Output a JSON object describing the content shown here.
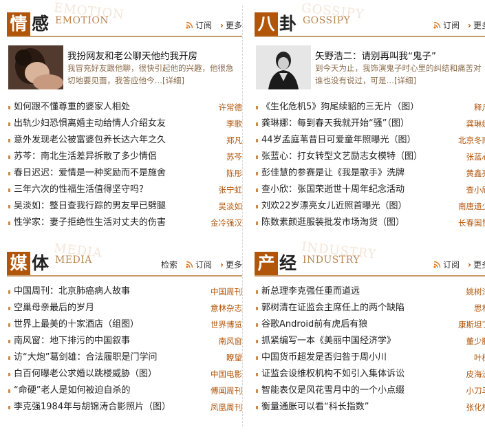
{
  "colors": {
    "accent": "#b1550a",
    "source": "#b1550a",
    "divider": "#c79a6b"
  },
  "emotion": {
    "title_first": "情",
    "title_second": "感",
    "title_en": "EMOTION",
    "links": {
      "subscribe": "订阅",
      "more": "更多"
    },
    "feature": {
      "title": "我扮网友和老公聊天他约我开房",
      "desc": "我冒充好友跟他聊，很快引起他的兴趣，他很急切地要见面，我答应他今…",
      "more": "[详细]"
    },
    "items": [
      {
        "title": "如何跟不懂尊重的婆家人相处",
        "source": "许常德"
      },
      {
        "title": "出轨少妇恐惧离婚主动给情人介绍女友",
        "source": "李歌"
      },
      {
        "title": "意外发现老公被富婆包养长达六年之久",
        "source": "郑凡"
      },
      {
        "title": "苏芩：南北生活差异拆散了多少情侣",
        "source": "苏芩"
      },
      {
        "title": "春日迟迟：爱情是一种奖励而不是施舍",
        "source": "陈彤"
      },
      {
        "title": "三年六次的性福生活值得坚守吗？",
        "source": "张宁虹"
      },
      {
        "title": "吴淡如：整日查我行踪的男友早已劈腿",
        "source": "吴淡如"
      },
      {
        "title": "性学家：妻子拒绝性生活对丈夫的伤害",
        "source": "金冷强汉"
      }
    ]
  },
  "gossip": {
    "title_first": "八",
    "title_second": "卦",
    "title_en": "GOSSIPY",
    "links": {
      "subscribe": "订阅",
      "more": "更多"
    },
    "feature": {
      "title": "矢野浩二：请别再叫我“鬼子”",
      "desc": "到今天为止，我饰演鬼子时心里的纠结和痛苦对谁也没有说过，可是…",
      "more": "[详细]"
    },
    "items": [
      {
        "title": "《生化危机5》狗尾续貂的三无片（图）",
        "source": "释凡"
      },
      {
        "title": "龚琳娜：每到春天我就开始“骚”（图）",
        "source": "龚琳娜"
      },
      {
        "title": "44岁孟庭苇昔日可爱童年照曝光（图）",
        "source": "北京冬雨"
      },
      {
        "title": "张蓝心：打女转型文艺励志女模特（图）",
        "source": "张蓝心"
      },
      {
        "title": "彭佳慧的参赛是让《我是歌手》洗牌",
        "source": "黄鑫亮"
      },
      {
        "title": "查小欣：张国荣逝世十周年纪念活动",
        "source": "查小欣"
      },
      {
        "title": "刘欢22岁漂亮女儿近照首曝光（图）",
        "source": "南唐遗少"
      },
      {
        "title": "陈数素颜逛服装批发市场淘货（图）",
        "source": "长春国贸"
      }
    ]
  },
  "media": {
    "title_first": "媒",
    "title_second": "体",
    "title_en": "MEDIA",
    "links": {
      "search": "检索",
      "subscribe": "订阅",
      "more": "更多"
    },
    "items": [
      {
        "title": "中国周刊：北京肺癌病人故事",
        "source": "中国周刊"
      },
      {
        "title": "空巢母亲最后的岁月",
        "source": "意林杂志"
      },
      {
        "title": "世界上最美的十家酒店（组图）",
        "source": "世界博览"
      },
      {
        "title": "南风窗：地下排污的中国叙事",
        "source": "南风窗"
      },
      {
        "title": "访“大炮”葛剑雄：合法履职是门学问",
        "source": "瞭望"
      },
      {
        "title": "白百何曝老公求婚以跳楼威胁（图）",
        "source": "中国电影"
      },
      {
        "title": "“命硬”老人是如何被迫自杀的",
        "source": "傅闻周刊"
      },
      {
        "title": "李克强1984年与胡锦涛合影照片（图）",
        "source": "凤凰周刊"
      }
    ]
  },
  "industry": {
    "title_first": "产",
    "title_second": "经",
    "title_en": "INDUSTRY",
    "links": {
      "subscribe": "订阅",
      "more": "更多"
    },
    "items": [
      {
        "title": "新总理李克强任重而道远",
        "source": "姚树洁"
      },
      {
        "title": "郭树清在证监会主席任上的两个缺陷",
        "source": "思朴"
      },
      {
        "title": "谷歌Android前有虎后有狼",
        "source": "康斯坦丁"
      },
      {
        "title": "抓紧编写一本《美丽中国经济学》",
        "source": "董少鹏"
      },
      {
        "title": "中国货币超发是否归咎于周小川",
        "source": "叶檀"
      },
      {
        "title": "证监会设维权机构不如引入集体诉讼",
        "source": "皮海洲"
      },
      {
        "title": "智能表仅是风花雪月中的一个小点缀",
        "source": "小刀马"
      },
      {
        "title": "衡量通胀可以看“科长指数”",
        "source": "张化桥"
      }
    ]
  }
}
